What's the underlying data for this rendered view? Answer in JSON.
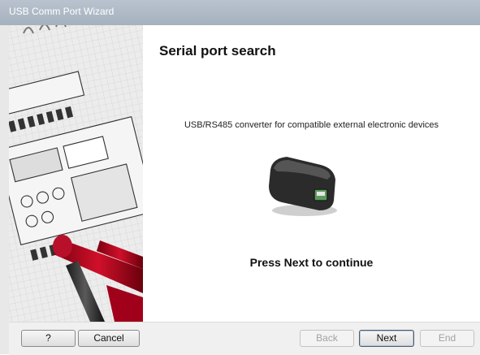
{
  "window": {
    "title": "USB Comm Port Wizard"
  },
  "page": {
    "heading": "Serial port search",
    "description": "USB/RS485 converter for compatible external electronic devices",
    "instruction": "Press Next to continue"
  },
  "buttons": {
    "help": "?",
    "cancel": "Cancel",
    "back": "Back",
    "next": "Next",
    "end": "End"
  },
  "colors": {
    "titlebar": "#b0bac6",
    "background": "#ffffff",
    "footer": "#f0f0f0",
    "device": "#2b2b2b",
    "connector": "#5c9c5c"
  }
}
